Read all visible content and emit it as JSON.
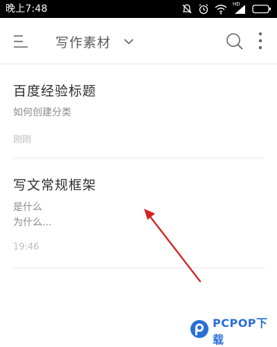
{
  "status_bar": {
    "time": "晚上7:48",
    "network_label": "HD"
  },
  "toolbar": {
    "title": "写作素材",
    "menu_icon": "menu-icon",
    "dropdown_icon": "chevron-down-icon",
    "search_icon": "search-icon",
    "more_icon": "more-vertical-icon"
  },
  "notes": [
    {
      "title": "百度经验标题",
      "snippet_lines": [
        "如何创建分类"
      ],
      "time": "刚刚"
    },
    {
      "title": "写文常规框架",
      "snippet_lines": [
        "是什么",
        "为什么..."
      ],
      "time": "19:46"
    }
  ],
  "annotation": {
    "color": "#d32424"
  },
  "watermark": {
    "text": "PCPOP下载",
    "color": "#2a6fd6"
  }
}
